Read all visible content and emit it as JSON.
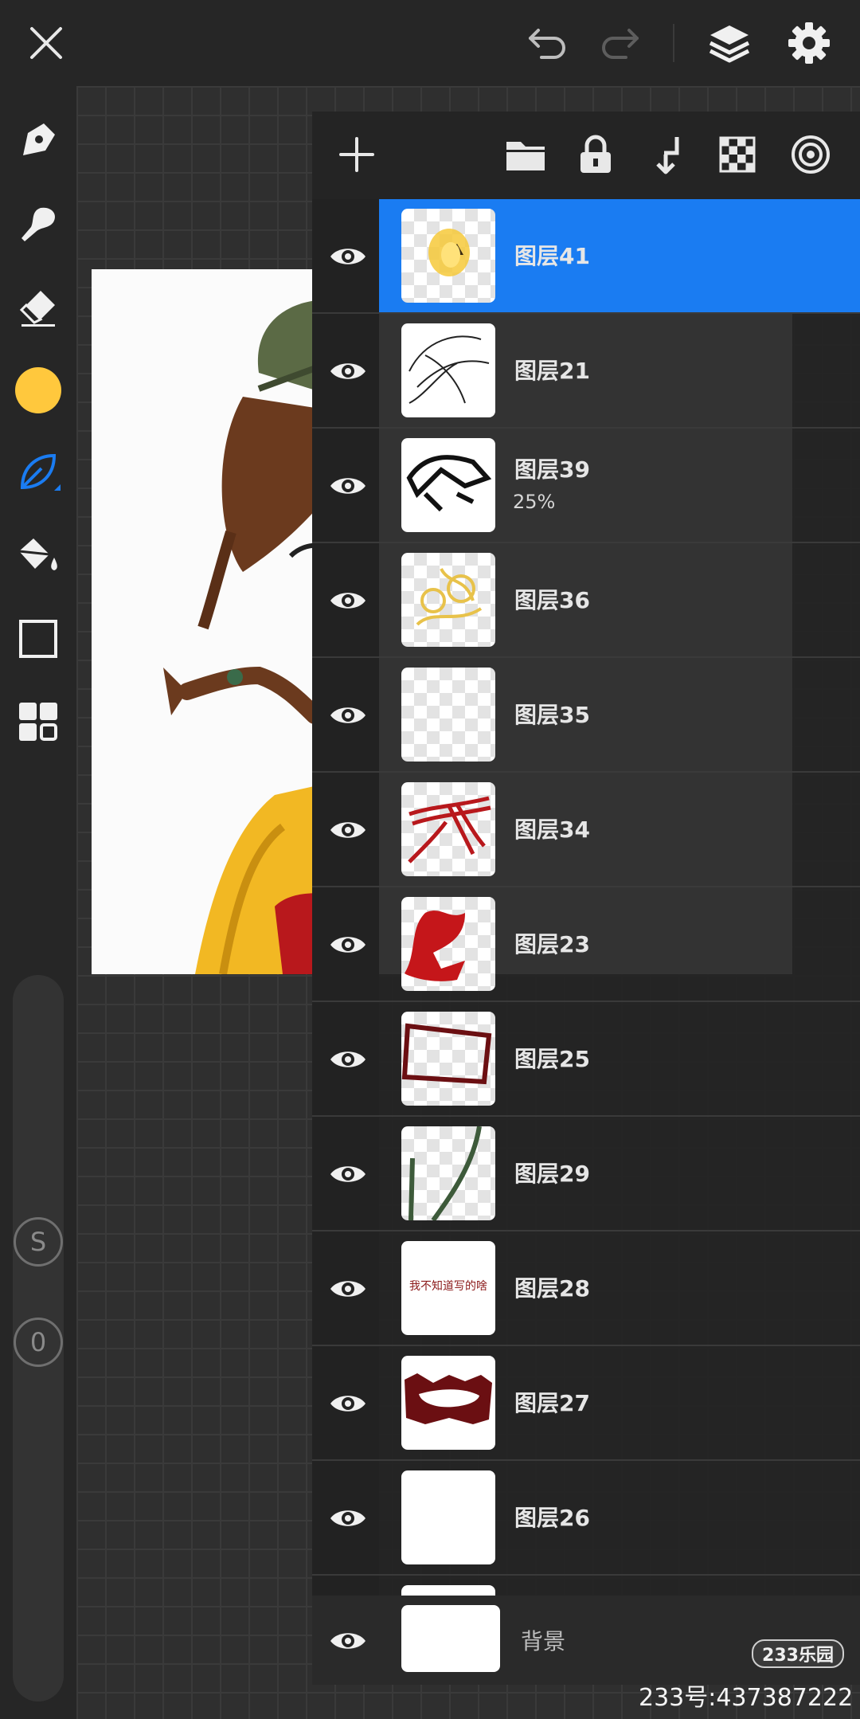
{
  "toolbar": {
    "icons": [
      "close-icon",
      "undo-icon",
      "redo-icon",
      "layers-icon",
      "settings-icon"
    ]
  },
  "tools": {
    "icons": [
      "pen-icon",
      "brush-icon",
      "eraser-icon",
      "color-picker",
      "leaf-brush-icon",
      "fill-bucket-icon",
      "rectangle-icon",
      "grid-icon"
    ],
    "color": "#ffc83d",
    "accent": "#1a7cf2",
    "size_label": "S",
    "opacity_label": "0"
  },
  "layers_panel": {
    "header_icons": [
      "add-icon",
      "folder-icon",
      "lock-icon",
      "merge-down-icon",
      "checker-icon",
      "target-icon"
    ],
    "layers": [
      {
        "name": "图层41",
        "opacity": ""
      },
      {
        "name": "图层21",
        "opacity": ""
      },
      {
        "name": "图层39",
        "opacity": "25%"
      },
      {
        "name": "图层36",
        "opacity": ""
      },
      {
        "name": "图层35",
        "opacity": ""
      },
      {
        "name": "图层34",
        "opacity": ""
      },
      {
        "name": "图层23",
        "opacity": ""
      },
      {
        "name": "图层25",
        "opacity": ""
      },
      {
        "name": "图层29",
        "opacity": ""
      },
      {
        "name": "图层28",
        "opacity": ""
      },
      {
        "name": "图层27",
        "opacity": ""
      },
      {
        "name": "图层26",
        "opacity": ""
      }
    ],
    "thumb_text_28": "我不知道写的啥",
    "background_label": "背景"
  },
  "watermark": {
    "logo": "233乐园",
    "text": "233号:437387222"
  }
}
